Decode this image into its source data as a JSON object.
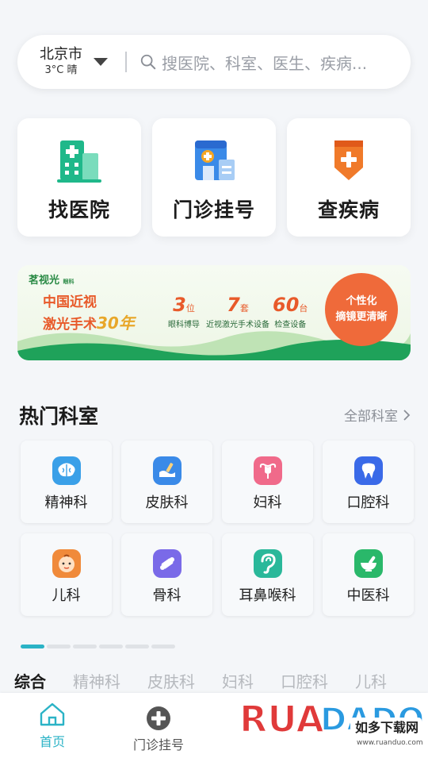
{
  "search": {
    "city": "北京市",
    "weather": "3°C 晴",
    "placeholder": "搜医院、科室、医生、疾病..."
  },
  "services": [
    {
      "label": "找医院",
      "icon": "hospital-building-icon"
    },
    {
      "label": "门诊挂号",
      "icon": "registration-clinic-icon"
    },
    {
      "label": "查疾病",
      "icon": "disease-shield-icon"
    }
  ],
  "banner": {
    "brand": "茗视光",
    "brand_sub": "眼科",
    "title_line1": "中国近视",
    "title_line2": "激光手术",
    "title_years": "30年",
    "stats": [
      {
        "num": "3",
        "unit": "位",
        "desc": "眼科博导"
      },
      {
        "num": "7",
        "unit": "套",
        "desc": "近视激光手术设备"
      },
      {
        "num": "60",
        "unit": "台",
        "desc": "检查设备"
      }
    ],
    "bubble_line1": "个性化",
    "bubble_line2": "摘镜更清晰"
  },
  "departments_section": {
    "title": "热门科室",
    "more": "全部科室"
  },
  "departments": [
    {
      "label": "精神科",
      "icon": "brain-icon",
      "color": "#3aa0e8"
    },
    {
      "label": "皮肤科",
      "icon": "skin-icon",
      "color": "#3a8ae8"
    },
    {
      "label": "妇科",
      "icon": "uterus-icon",
      "color": "#f06a8a"
    },
    {
      "label": "口腔科",
      "icon": "tooth-icon",
      "color": "#3a6ae8"
    },
    {
      "label": "儿科",
      "icon": "baby-face-icon",
      "color": "#f08a3a"
    },
    {
      "label": "骨科",
      "icon": "bone-icon",
      "color": "#7a6ae8"
    },
    {
      "label": "耳鼻喉科",
      "icon": "ear-icon",
      "color": "#2ab89a"
    },
    {
      "label": "中医科",
      "icon": "mortar-bowl-icon",
      "color": "#2ab86a"
    }
  ],
  "page_dots": {
    "count": 6,
    "active": 0
  },
  "category_tabs": [
    "综合",
    "精神科",
    "皮肤科",
    "妇科",
    "口腔科",
    "儿科"
  ],
  "category_active": 0,
  "bottom_nav": {
    "home": "首页",
    "registration": "门诊挂号"
  },
  "watermark": {
    "brand": "RUANDAO",
    "cn": "如多下载网",
    "url": "www.ruanduo.com"
  },
  "colors": {
    "accent": "#2bb3c6",
    "banner_orange": "#e85a2a",
    "banner_green": "#2a8a45"
  }
}
